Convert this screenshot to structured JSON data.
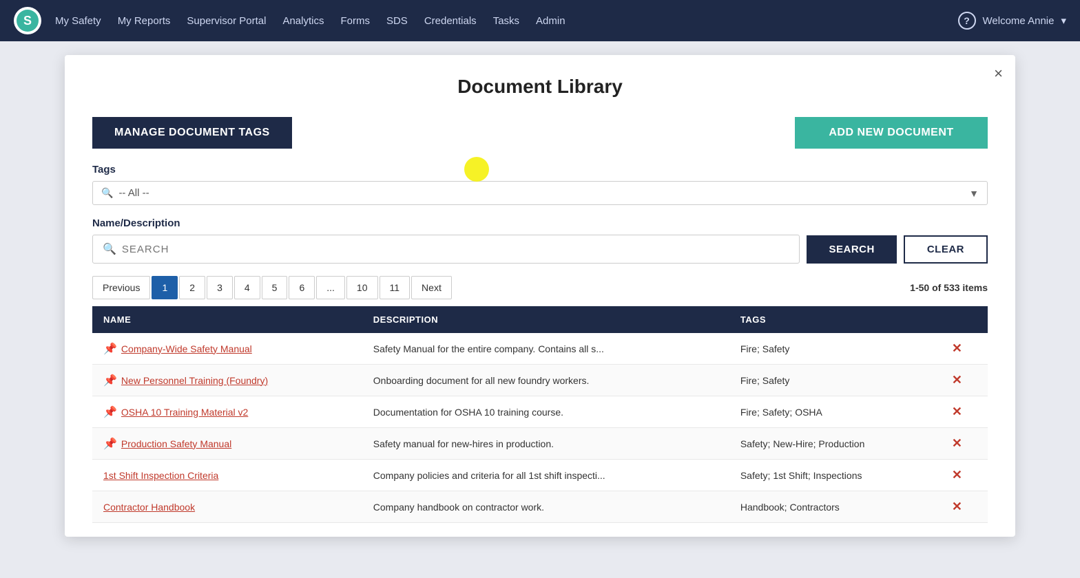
{
  "nav": {
    "logo_letter": "S",
    "links": [
      "My Safety",
      "My Reports",
      "Supervisor Portal",
      "Analytics",
      "Forms",
      "SDS",
      "Credentials",
      "Tasks",
      "Admin"
    ],
    "welcome": "Welcome Annie"
  },
  "modal": {
    "title": "Document Library",
    "close_label": "×",
    "manage_btn": "MANAGE DOCUMENT TAGS",
    "add_btn": "ADD NEW DOCUMENT"
  },
  "tags_section": {
    "label": "Tags",
    "placeholder": "-- All --"
  },
  "search_section": {
    "label": "Name/Description",
    "search_placeholder": "SEARCH",
    "search_btn": "SEARCH",
    "clear_btn": "CLEAR"
  },
  "pagination": {
    "prev": "Previous",
    "next": "Next",
    "pages": [
      "1",
      "2",
      "3",
      "4",
      "5",
      "6",
      "...",
      "10",
      "11"
    ],
    "active_page": "1",
    "items_count": "1-50 of 533 items"
  },
  "table": {
    "columns": [
      "NAME",
      "DESCRIPTION",
      "TAGS",
      ""
    ],
    "rows": [
      {
        "name": "Company-Wide Safety Manual",
        "has_icon": true,
        "description": "Safety Manual for the entire company. Contains all s...",
        "tags": "Fire; Safety"
      },
      {
        "name": "New Personnel Training (Foundry)",
        "has_icon": true,
        "description": "Onboarding document for all new foundry workers.",
        "tags": "Fire; Safety"
      },
      {
        "name": "OSHA 10 Training Material v2",
        "has_icon": true,
        "description": "Documentation for OSHA 10 training course.",
        "tags": "Fire; Safety; OSHA"
      },
      {
        "name": "Production Safety Manual",
        "has_icon": true,
        "description": "Safety manual for new-hires in production.",
        "tags": "Safety; New-Hire; Production"
      },
      {
        "name": "1st Shift Inspection Criteria",
        "has_icon": false,
        "description": "Company policies and criteria for all 1st shift inspecti...",
        "tags": "Safety; 1st Shift; Inspections"
      },
      {
        "name": "Contractor Handbook",
        "has_icon": false,
        "description": "Company handbook on contractor work.",
        "tags": "Handbook; Contractors"
      }
    ]
  }
}
